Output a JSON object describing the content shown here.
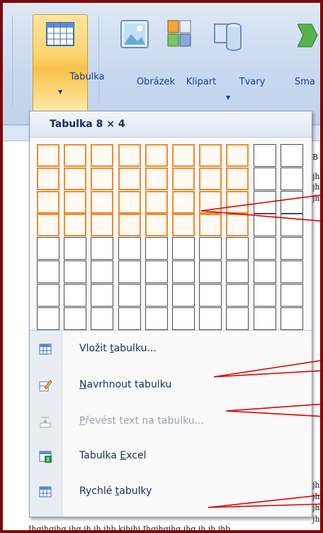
{
  "ribbon": {
    "buttons": [
      {
        "label": "Tabulka",
        "icon": "table-icon"
      },
      {
        "label": "Obrázek",
        "icon": "picture-icon"
      },
      {
        "label": "Klipart",
        "icon": "clipart-icon"
      },
      {
        "label": "Tvary",
        "icon": "shapes-icon"
      },
      {
        "label": "Sma",
        "icon": "smartart-icon"
      }
    ]
  },
  "dropdown": {
    "title": "Tabulka 8 × 4",
    "grid": {
      "columns": 10,
      "rows": 8,
      "selected_columns": 8,
      "selected_rows": 4
    },
    "menu": [
      {
        "pre": "Vložit ",
        "u": "t",
        "post": "abulku...",
        "icon": "insert-table-icon",
        "enabled": true
      },
      {
        "pre": "",
        "u": "N",
        "post": "avrhnout tabulku",
        "icon": "draw-table-icon",
        "enabled": true
      },
      {
        "pre": "",
        "u": "P",
        "post": "řevést text na tabulku...",
        "icon": "convert-text-icon",
        "enabled": false
      },
      {
        "pre": "Tabulka ",
        "u": "E",
        "post": "xcel",
        "icon": "excel-table-icon",
        "enabled": true
      },
      {
        "pre": "Rychlé ",
        "u": "t",
        "post": "abulky",
        "icon": "quick-tables-icon",
        "enabled": true
      }
    ]
  },
  "document": {
    "bottom_line": "Ihgjhgjhg jhg jh jh jhb kjhjhj Ihgjhgjhg jhg jh jh jhb",
    "right_fragments": [
      "B ·",
      "jhi",
      "jhi",
      "jhi",
      "jhg",
      "jhl",
      "jhl",
      "jhl",
      "jhi"
    ]
  },
  "colors": {
    "frame": "#7d0707",
    "selected_cell": "#f28a2e",
    "ribbon_text": "#15428b",
    "callout": "#e00000"
  }
}
